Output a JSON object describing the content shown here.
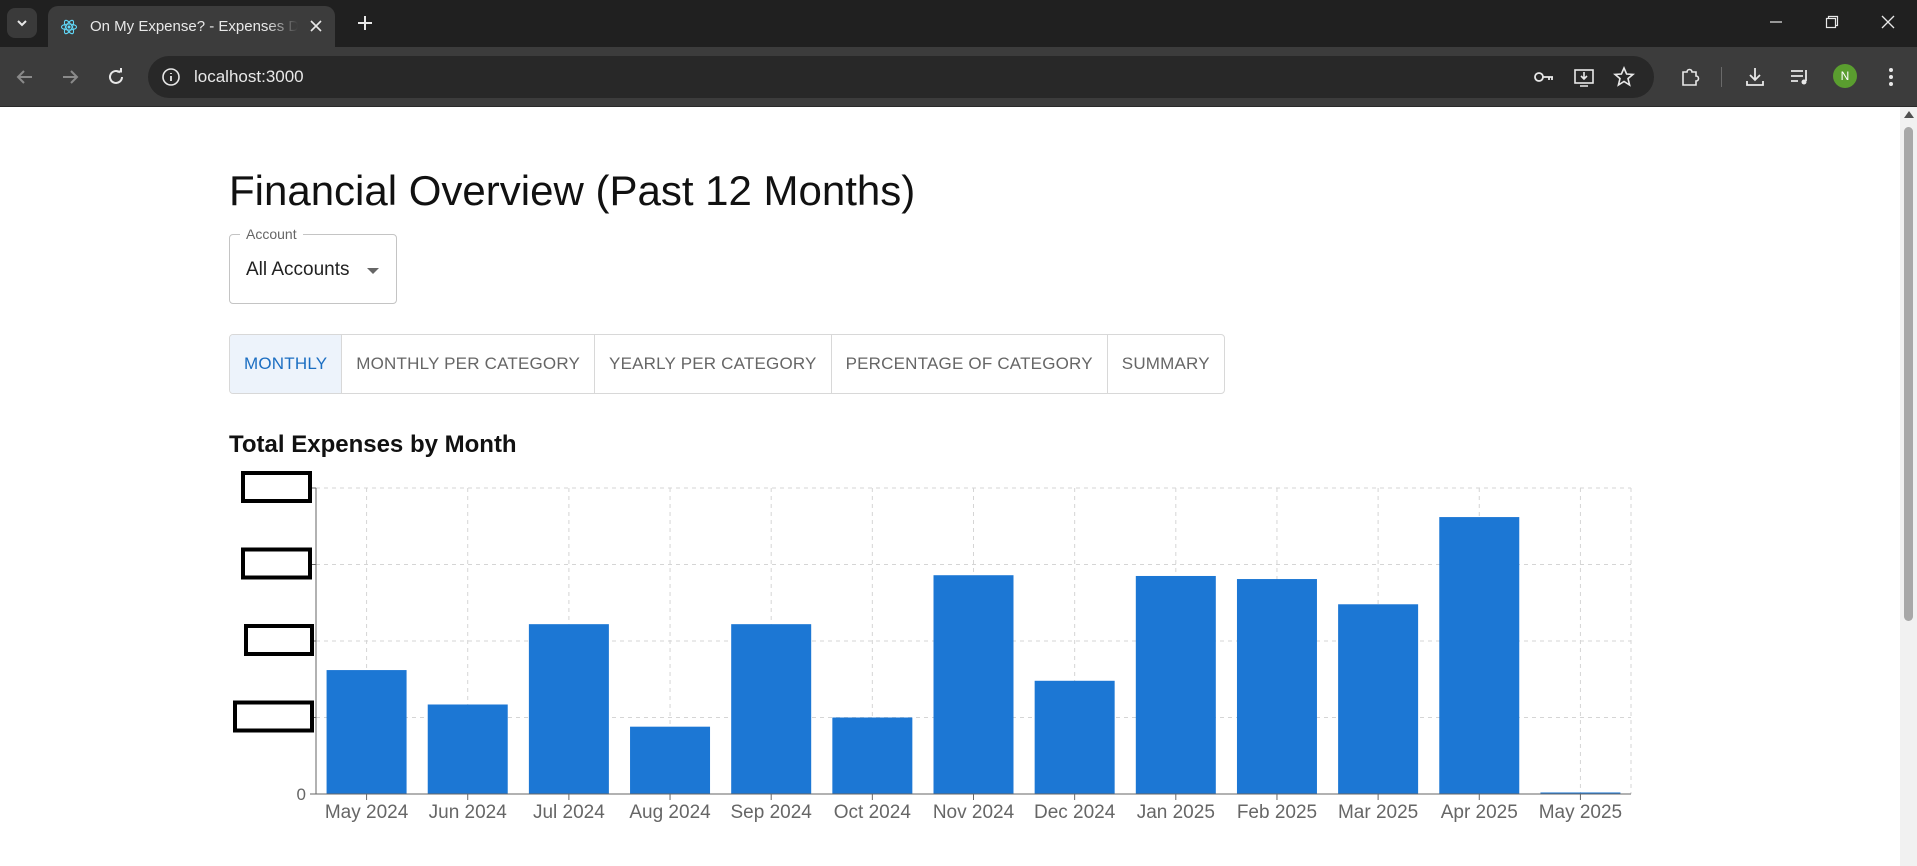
{
  "browser": {
    "tab_title": "On My Expense? - Expenses Dashboard",
    "url": "localhost:3000",
    "profile_initial": "N"
  },
  "page": {
    "title": "Financial Overview (Past 12 Months)",
    "account": {
      "label": "Account",
      "value": "All Accounts"
    },
    "view_tabs": [
      {
        "label": "MONTHLY",
        "active": true
      },
      {
        "label": "MONTHLY PER CATEGORY",
        "active": false
      },
      {
        "label": "YEARLY PER CATEGORY",
        "active": false
      },
      {
        "label": "PERCENTAGE OF CATEGORY",
        "active": false
      },
      {
        "label": "SUMMARY",
        "active": false
      }
    ],
    "chart_title": "Total Expenses by Month"
  },
  "colors": {
    "bar": "#1c77d4",
    "active_tab": "#1b6ec2",
    "grid": "#d5d5d5"
  },
  "chart_data": {
    "type": "bar",
    "title": "Total Expenses by Month",
    "categories": [
      "May 2024",
      "Jun 2024",
      "Jul 2024",
      "Aug 2024",
      "Sep 2024",
      "Oct 2024",
      "Nov 2024",
      "Dec 2024",
      "Jan 2025",
      "Feb 2025",
      "Mar 2025",
      "Apr 2025",
      "May 2025"
    ],
    "values": [
      1.62,
      1.17,
      2.22,
      0.88,
      2.22,
      1.0,
      2.86,
      1.48,
      2.85,
      2.81,
      2.48,
      3.62,
      0.02
    ],
    "y_ticks": [
      "0",
      "",
      "",
      "",
      ""
    ],
    "y_tick_values_redacted": true,
    "ylim": [
      0,
      4
    ],
    "grid": true,
    "legend": "none"
  }
}
